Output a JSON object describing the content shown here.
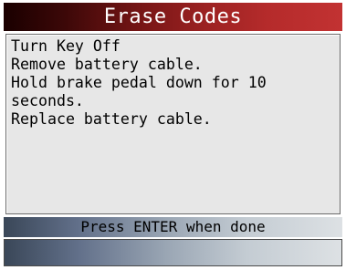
{
  "header": {
    "title": "Erase Codes"
  },
  "content": {
    "lines": [
      "Turn Key Off",
      "Remove battery cable.",
      "Hold brake pedal down for 10",
      "seconds.",
      "Replace battery cable."
    ]
  },
  "status": {
    "prompt": "Press ENTER when done"
  },
  "colors": {
    "title_bar_left": "#1a0000",
    "title_bar_right": "#c23232",
    "panel_background": "#e7e7e7",
    "status_bar_left": "#3a4758",
    "status_bar_right": "#dde1e4"
  }
}
